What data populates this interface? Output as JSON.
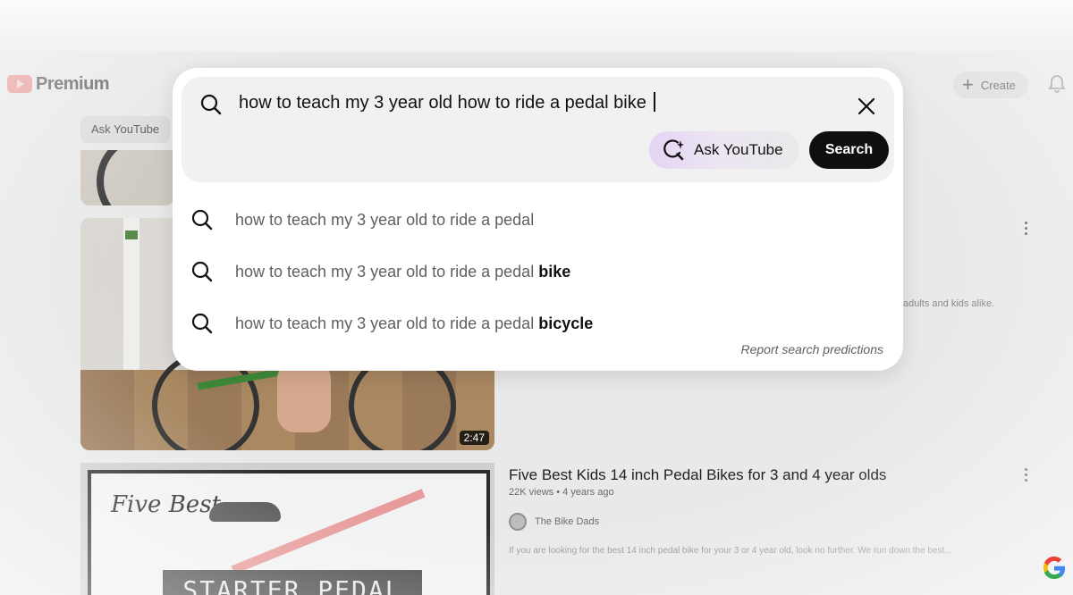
{
  "brand": {
    "logo_word": "Premium"
  },
  "header": {
    "create_label": "Create",
    "ask_chip_label": "Ask YouTube"
  },
  "search": {
    "query": "how to teach my 3 year old how to ride a pedal bike",
    "ask_button_label": "Ask YouTube",
    "search_button_label": "Search",
    "suggestions": [
      {
        "prefix": "how to teach my 3 year old to ride a pedal",
        "bold": ""
      },
      {
        "prefix": "how to teach my 3 year old to ride a pedal",
        "bold": "bike"
      },
      {
        "prefix": "how to teach my 3 year old to ride a pedal",
        "bold": "bicycle"
      }
    ],
    "report_label": "Report search predictions"
  },
  "results": {
    "first": {
      "duration": "2:47",
      "desc_snippet": "adults and kids alike."
    },
    "second": {
      "title": "Five Best Kids 14 inch Pedal Bikes for 3 and 4 year olds",
      "meta": "22K views • 4 years ago",
      "channel": "The Bike Dads",
      "description": "If you are looking for the best 14 inch pedal bike for your 3 or 4 year old, look no further. We run down the best...",
      "thumb_script": "Five Best",
      "thumb_banner": "STARTER PEDAL BIKES"
    }
  },
  "colors": {
    "search_button": "#0f0f0f",
    "ask_gradient_start": "#e4d4f4",
    "page_dim": "#e9e9e9"
  },
  "icons": [
    "search-icon",
    "close-icon",
    "sparkle-search-icon",
    "plus-icon",
    "bell-icon",
    "more-vert-icon",
    "google-logo-icon"
  ]
}
